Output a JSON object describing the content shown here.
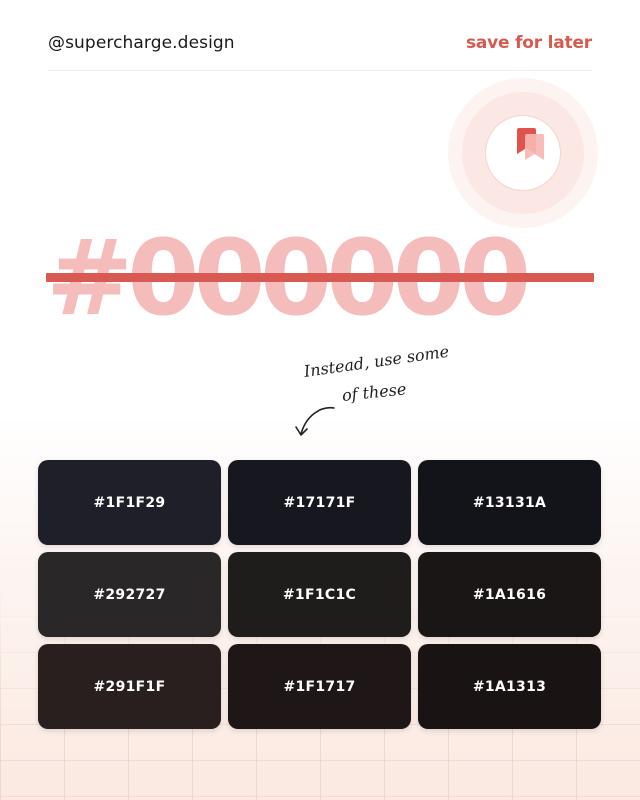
{
  "header": {
    "handle": "@supercharge.design",
    "save_label": "save for later"
  },
  "colors": {
    "accent": "#d65a4f",
    "hex_fill": "#f5bcbc",
    "strike": "#d85a52"
  },
  "icons": {
    "bookmark": "bookmark-icon",
    "arrow": "curved-arrow-icon"
  },
  "hero": {
    "hex": "#000000"
  },
  "note": {
    "line1": "Instead, use some",
    "line2": "of these"
  },
  "swatches": [
    {
      "label": "#1F1F29",
      "color": "#1F1F29"
    },
    {
      "label": "#17171F",
      "color": "#17171F"
    },
    {
      "label": "#13131A",
      "color": "#13131A"
    },
    {
      "label": "#292727",
      "color": "#292727"
    },
    {
      "label": "#1F1C1C",
      "color": "#1F1C1C"
    },
    {
      "label": "#1A1616",
      "color": "#1A1616"
    },
    {
      "label": "#291F1F",
      "color": "#291F1F"
    },
    {
      "label": "#1F1717",
      "color": "#1F1717"
    },
    {
      "label": "#1A1313",
      "color": "#1A1313"
    }
  ]
}
